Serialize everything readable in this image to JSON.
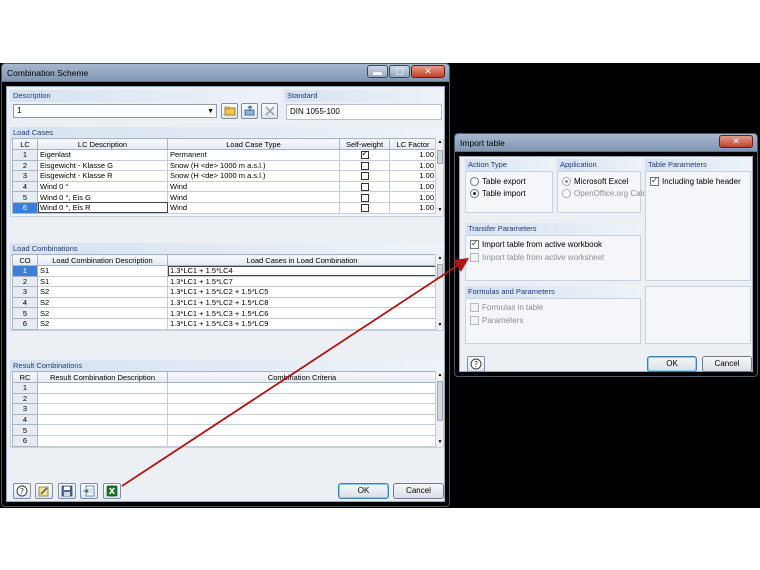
{
  "combination_scheme": {
    "title": "Combination Scheme",
    "window_buttons": {
      "minimize": "▬",
      "maximize": "▢",
      "close": "✕"
    },
    "description": {
      "label": "Description",
      "value": "1"
    },
    "standard": {
      "label": "Standard",
      "value": "DIN 1055-100"
    },
    "load_cases": {
      "label": "Load Cases",
      "columns": [
        "LC",
        "LC Description",
        "Load Case Type",
        "Self-weight",
        "LC Factor"
      ],
      "rows": [
        {
          "lc": "1",
          "desc": "Eigenlast",
          "type": "Permanent",
          "self_weight": true,
          "factor": "1.00"
        },
        {
          "lc": "2",
          "desc": "Eisgewicht - Klasse G",
          "type": "Snow (H <de> 1000 m a.s.l.)",
          "self_weight": false,
          "factor": "1.00"
        },
        {
          "lc": "3",
          "desc": "Eisgewicht - Klasse R",
          "type": "Snow (H <de> 1000 m a.s.l.)",
          "self_weight": false,
          "factor": "1.00"
        },
        {
          "lc": "4",
          "desc": "Wind 0 °",
          "type": "Wind",
          "self_weight": false,
          "factor": "1.00"
        },
        {
          "lc": "5",
          "desc": "Wind 0 °, Eis G",
          "type": "Wind",
          "self_weight": false,
          "factor": "1.00"
        },
        {
          "lc": "6",
          "desc": "Wind 0 °, Eis R",
          "type": "Wind",
          "self_weight": false,
          "factor": "1.00"
        }
      ]
    },
    "load_combinations": {
      "label": "Load Combinations",
      "columns": [
        "CO",
        "Load Combination Description",
        "Load Cases in Load Combination"
      ],
      "rows": [
        {
          "co": "1",
          "desc": "S1",
          "cases": "1.3*LC1 + 1.5*LC4"
        },
        {
          "co": "2",
          "desc": "S1",
          "cases": "1.3*LC1 + 1.5*LC7"
        },
        {
          "co": "3",
          "desc": "S2",
          "cases": "1.3*LC1 + 1.5*LC2 + 1.5*LC5"
        },
        {
          "co": "4",
          "desc": "S2",
          "cases": "1.3*LC1 + 1.5*LC2 + 1.5*LC8"
        },
        {
          "co": "5",
          "desc": "S2",
          "cases": "1.3*LC1 + 1.5*LC3 + 1.5*LC6"
        },
        {
          "co": "6",
          "desc": "S2",
          "cases": "1.3*LC1 + 1.5*LC3 + 1.5*LC9"
        }
      ]
    },
    "result_combinations": {
      "label": "Result Combinations",
      "columns": [
        "RC",
        "Result Combination Description",
        "Combination Criteria"
      ],
      "rows": [
        "1",
        "2",
        "3",
        "4",
        "5",
        "6"
      ]
    },
    "buttons": {
      "ok": "OK",
      "cancel": "Cancel"
    }
  },
  "import_table": {
    "title": "Import table",
    "close_glyph": "✕",
    "action_type": {
      "label": "Action Type",
      "options": [
        "Table export",
        "Table import"
      ],
      "selected": "Table import"
    },
    "application": {
      "label": "Application",
      "options": [
        "Microsoft Excel",
        "OpenOffice.org Calc"
      ],
      "selected": "Microsoft Excel"
    },
    "table_parameters": {
      "label": "Table Parameters",
      "including_header": "Including table header"
    },
    "transfer_parameters": {
      "label": "Transfer Parameters",
      "active_workbook": "Import table from active workbook",
      "active_worksheet": "Import table from active worksheet"
    },
    "formulas_parameters": {
      "label": "Formulas and Parameters",
      "formulas": "Formulas in table",
      "parameters": "Parameters"
    },
    "buttons": {
      "ok": "OK",
      "cancel": "Cancel"
    }
  },
  "colors": {
    "annotation_arrow": "#b01515",
    "selection": "#3b7fd9",
    "section_header_text": "#1e3c78"
  }
}
